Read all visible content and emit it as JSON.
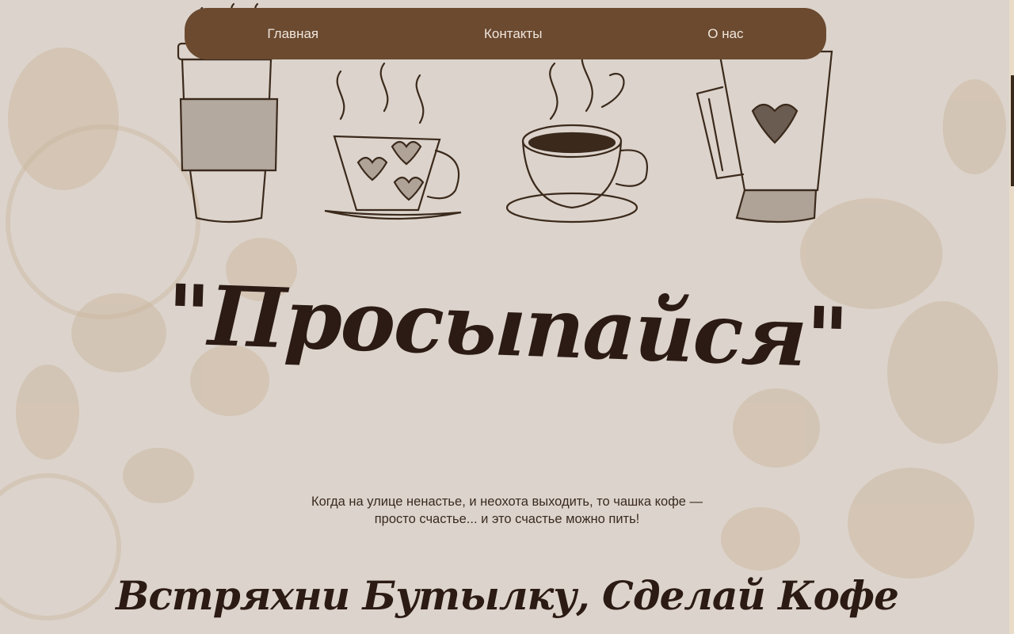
{
  "nav": {
    "items": [
      {
        "label": "Главная"
      },
      {
        "label": "Контакты"
      },
      {
        "label": "О нас"
      }
    ]
  },
  "hero": {
    "title": "\"Просыпайся\"",
    "description_line1": "Когда на улице ненастье, и неохота выходить, то чашка кофе —",
    "description_line2": "просто счастье... и это счастье можно пить!",
    "slogan": "Встряхни Бутылку, Сделай Кофе"
  },
  "colors": {
    "background": "#dcd4cc",
    "nav": "#6b4a30",
    "ink": "#2b1b14"
  }
}
